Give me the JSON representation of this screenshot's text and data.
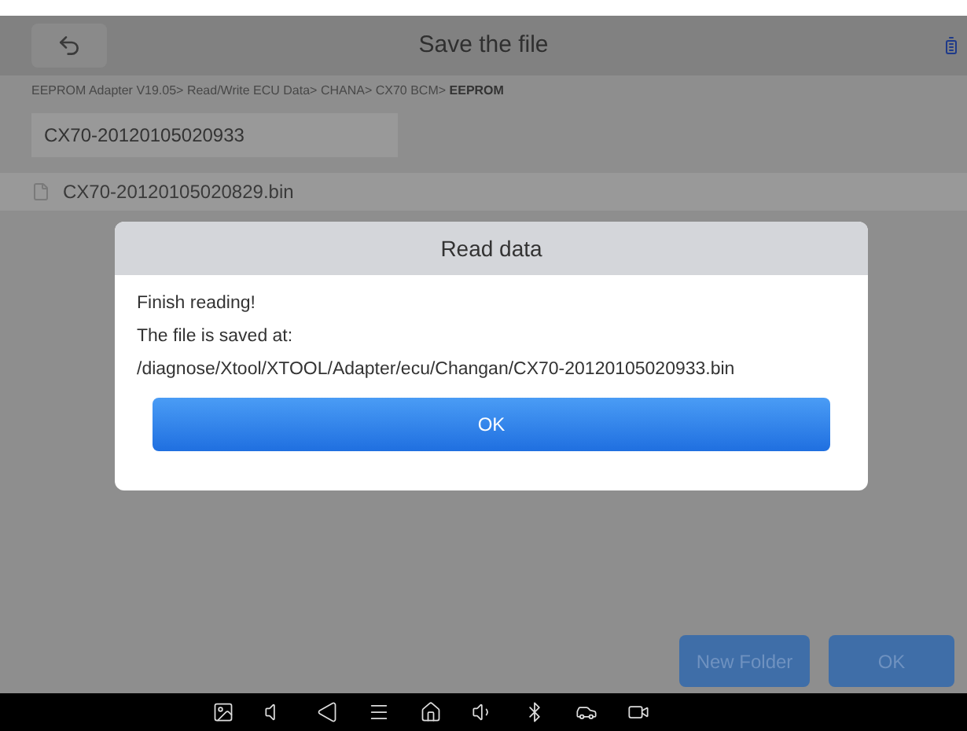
{
  "header": {
    "title": "Save the file"
  },
  "breadcrumb": {
    "path": "EEPROM Adapter V19.05> Read/Write ECU Data> CHANA> CX70 BCM>",
    "current": "EEPROM"
  },
  "file_name_field": {
    "value": "CX70-20120105020933"
  },
  "files": [
    {
      "name": "CX70-20120105020829.bin"
    }
  ],
  "dialog": {
    "title": "Read data",
    "lines": [
      "Finish reading!",
      "The file is saved at:",
      "/diagnose/Xtool/XTOOL/Adapter/ecu/Changan/CX70-20120105020933.bin"
    ],
    "button": "OK"
  },
  "buttons": [
    "New Folder",
    "OK"
  ],
  "nav_bar": [
    {
      "kind": "screenshot"
    },
    {
      "kind": "volume-down"
    },
    {
      "kind": "back"
    },
    {
      "kind": "menu"
    },
    {
      "kind": "home"
    },
    {
      "kind": "volume-up"
    },
    {
      "kind": "bluetooth"
    },
    {
      "kind": "car"
    },
    {
      "kind": "record"
    }
  ]
}
